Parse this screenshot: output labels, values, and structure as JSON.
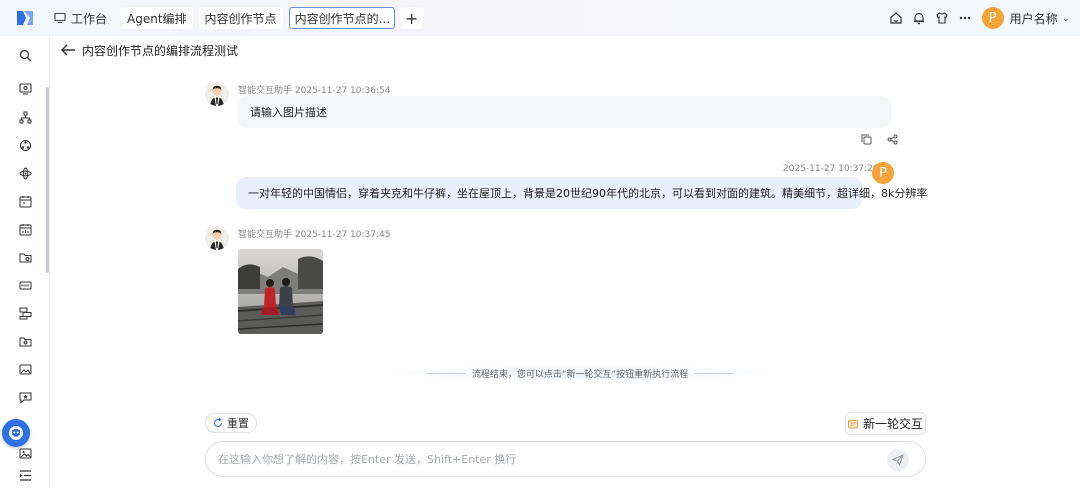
{
  "topbar": {
    "tabs": [
      {
        "label": "工作台"
      },
      {
        "label": "Agent编排"
      },
      {
        "label": "内容创作节点"
      },
      {
        "label": "内容创作节点的..."
      }
    ],
    "add_label": "+",
    "user": {
      "avatar_letter": "P",
      "name": "用户名称",
      "chevron": "⌄"
    }
  },
  "page": {
    "title": "内容创作节点的编排流程测试"
  },
  "messages": [
    {
      "role": "bot",
      "sender": "智能交互助手",
      "time": "2025-11-27 10:36:54",
      "text": "请输入图片描述"
    },
    {
      "role": "user",
      "time": "2025-11-27 10:37:26",
      "avatar_letter": "P",
      "text": "一对年轻的中国情侣，穿着夹克和牛仔裤，坐在屋顶上，背景是20世纪90年代的北京，可以看到对面的建筑。精美细节，超详细，8k分辨率"
    },
    {
      "role": "bot",
      "sender": "智能交互助手",
      "time": "2025-11-27 10:37:45",
      "image": "couple-on-rooftop-image"
    }
  ],
  "end_notice": "流程结束，您可以点击“新一轮交互”按钮重新执行流程",
  "controls": {
    "reset_label": "重置",
    "new_round_label": "新一轮交互",
    "input_placeholder": "在这输入你想了解的内容，按Enter 发送，Shift+Enter 换行"
  },
  "colors": {
    "accent": "#2f6fe8",
    "avatar": "#f6a33a",
    "user_bubble": "#e9effd",
    "bot_bubble": "#f5f6f8"
  }
}
